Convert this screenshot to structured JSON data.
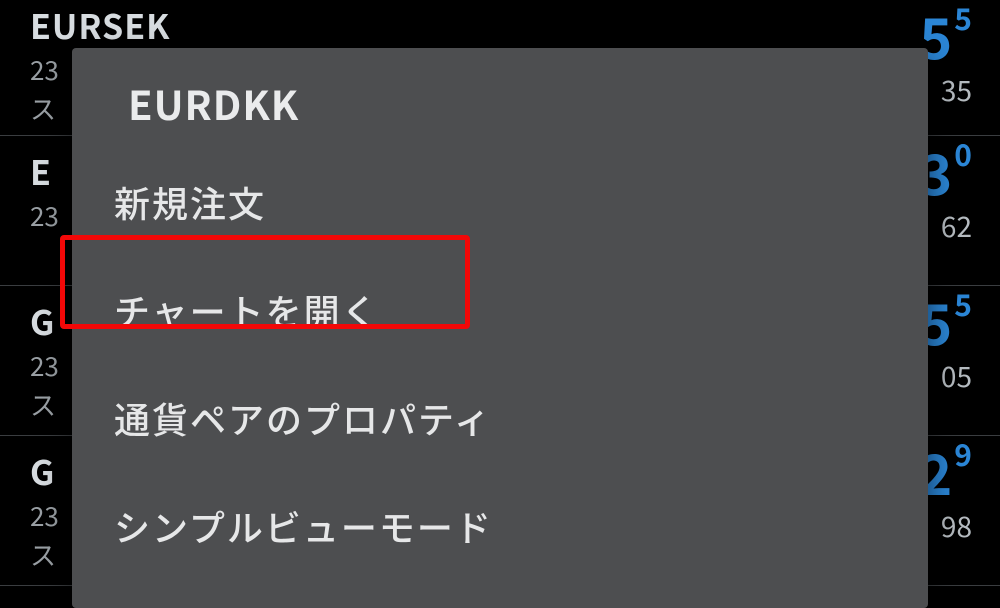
{
  "background": {
    "rows": [
      {
        "symbol": "EURSEK",
        "sub": "23",
        "extra": "ス",
        "bigColor": "blue",
        "big": "5",
        "sup": "5",
        "small": "35"
      },
      {
        "symbol": "E",
        "sub": "23",
        "extra": "",
        "bigColor": "blue",
        "big": "3",
        "sup": "0",
        "small": "62"
      },
      {
        "symbol": "G",
        "sub": "23",
        "extra": "ス",
        "bigColor": "blue",
        "big": "5",
        "sup": "5",
        "small": "05"
      },
      {
        "symbol": "G",
        "sub": "23",
        "extra": "ス",
        "bigColor": "blue",
        "big": "2",
        "sup": "9",
        "small": "98"
      }
    ]
  },
  "panel": {
    "title": "EURDKK",
    "items": [
      {
        "label": "新規注文"
      },
      {
        "label": "チャートを開く"
      },
      {
        "label": "通貨ペアのプロパティ"
      },
      {
        "label": "シンプルビューモード"
      }
    ]
  }
}
